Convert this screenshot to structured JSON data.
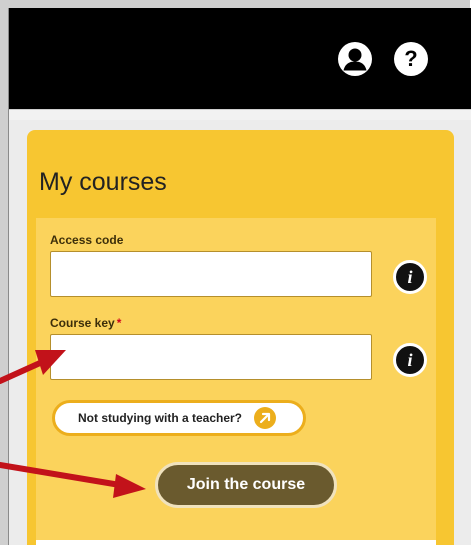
{
  "header": {
    "profile_icon": "user-icon",
    "help_icon": "help-icon",
    "help_glyph": "?"
  },
  "courses": {
    "title": "My courses",
    "access_code": {
      "label": "Access code",
      "value": "",
      "placeholder": ""
    },
    "course_key": {
      "label": "Course key",
      "required_mark": "*",
      "value": "",
      "placeholder": ""
    },
    "info_glyph": "i",
    "no_teacher_label": "Not studying with a teacher?",
    "join_label": "Join the course"
  },
  "annotations": {
    "arrow_color": "#c2121a",
    "arrow_targets": [
      "course-key-field",
      "join-course-button"
    ]
  },
  "colors": {
    "header_bg": "#000000",
    "card_bg": "#f7c631",
    "card_inner_bg": "#fbd35c",
    "pill_accent": "#ecae1c",
    "join_bg": "#6a5a2e"
  }
}
